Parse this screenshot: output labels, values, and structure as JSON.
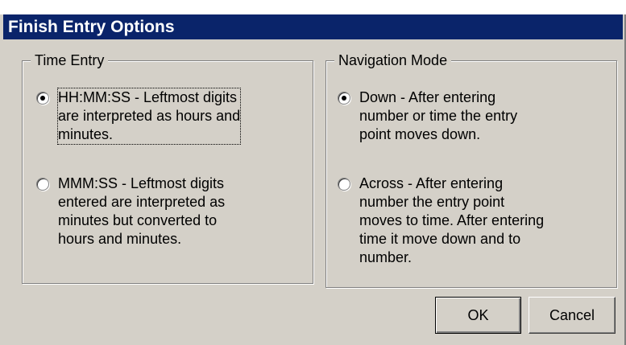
{
  "window": {
    "title": "Finish Entry Options"
  },
  "time_entry": {
    "group_label": "Time Entry",
    "options": [
      {
        "label": "HH:MM:SS - Leftmost digits\nare interpreted as hours and\nminutes.",
        "selected": true
      },
      {
        "label": "MMM:SS - Leftmost digits\nentered are interpreted as\nminutes but converted to\nhours and minutes.",
        "selected": false
      }
    ]
  },
  "navigation_mode": {
    "group_label": "Navigation Mode",
    "options": [
      {
        "label": "Down - After entering\nnumber or time the entry\npoint moves down.",
        "selected": true
      },
      {
        "label": "Across - After entering\nnumber the entry point\nmoves to time. After entering\ntime it move down and to\nnumber.",
        "selected": false
      }
    ]
  },
  "buttons": {
    "ok_label": "OK",
    "cancel_label": "Cancel"
  }
}
